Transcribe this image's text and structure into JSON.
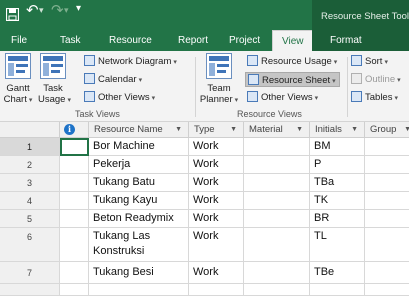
{
  "quick_access": {
    "save_icon": "save-icon",
    "undo_icon": "undo-icon",
    "redo_icon": "redo-icon",
    "customize_icon": "customize-quick-access-icon"
  },
  "contextual_tab_title": "Resource Sheet Tools",
  "tabs": [
    {
      "label": "File"
    },
    {
      "label": "Task"
    },
    {
      "label": "Resource"
    },
    {
      "label": "Report"
    },
    {
      "label": "Project"
    },
    {
      "label": "View",
      "active": true
    },
    {
      "label": "Format"
    }
  ],
  "ribbon": {
    "task_views": {
      "group_label": "Task Views",
      "gantt_label_1": "Gantt",
      "gantt_label_2": "Chart",
      "task_usage_label_1": "Task",
      "task_usage_label_2": "Usage",
      "network_diagram": "Network Diagram",
      "calendar": "Calendar",
      "other_views": "Other Views"
    },
    "resource_views": {
      "group_label": "Resource Views",
      "team_planner_label_1": "Team",
      "team_planner_label_2": "Planner",
      "resource_usage": "Resource Usage",
      "resource_sheet": "Resource Sheet",
      "other_views": "Other Views"
    },
    "data": {
      "sort": "Sort",
      "outline": "Outline",
      "tables": "Tables"
    }
  },
  "sheet": {
    "columns": [
      "Resource Name",
      "Type",
      "Material",
      "Initials",
      "Group"
    ],
    "rows": [
      {
        "num": "1",
        "name": "Bor Machine",
        "type": "Work",
        "material": "",
        "initials": "BM"
      },
      {
        "num": "2",
        "name": "Pekerja",
        "type": "Work",
        "material": "",
        "initials": "P"
      },
      {
        "num": "3",
        "name": "Tukang Batu",
        "type": "Work",
        "material": "",
        "initials": "TBa"
      },
      {
        "num": "4",
        "name": "Tukang Kayu",
        "type": "Work",
        "material": "",
        "initials": "TK"
      },
      {
        "num": "5",
        "name": "Beton Readymix",
        "type": "Work",
        "material": "",
        "initials": "BR"
      },
      {
        "num": "6",
        "name": "Tukang Las Konstruksi",
        "type": "Work",
        "material": "",
        "initials": "TL"
      },
      {
        "num": "7",
        "name": "Tukang Besi",
        "type": "Work",
        "material": "",
        "initials": "TBe"
      }
    ]
  },
  "colors": {
    "accent": "#227447",
    "contextual": "#1b5e38"
  }
}
